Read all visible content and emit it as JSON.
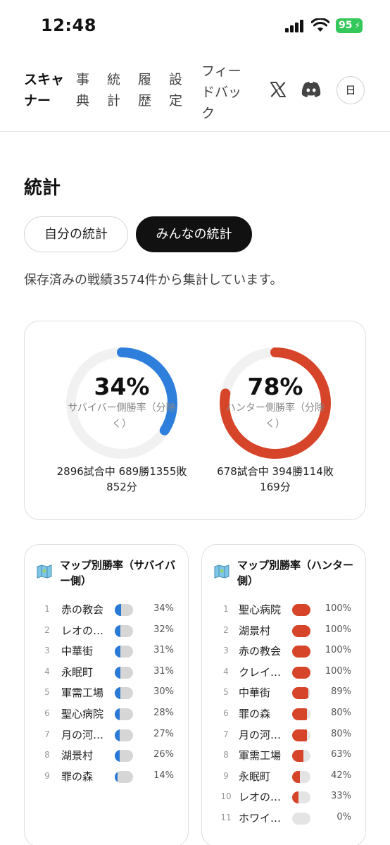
{
  "status_bar": {
    "time": "12:48",
    "battery": "95"
  },
  "nav": {
    "scanner": "スキャ\nナー",
    "dictionary": "事\n典",
    "stats": "統\n計",
    "history": "履\n歴",
    "settings": "設\n定",
    "feedback": "フィー\nドバッ\nク",
    "lang": "日"
  },
  "page": {
    "title": "統計",
    "tab_mine": "自分の統計",
    "tab_all": "みんなの統計",
    "summary": "保存済みの戦績3574件から集計しています。"
  },
  "overview": {
    "survivor": {
      "percent_text": "34%",
      "percent_value": 34,
      "label": "サバイバー側勝率（分除く）",
      "record_line1": "2896試合中 689勝1355敗",
      "record_line2": "852分",
      "color": "#2e7fdc"
    },
    "hunter": {
      "percent_text": "78%",
      "percent_value": 78,
      "label": "ハンター側勝率（分除く）",
      "record_line1": "678試合中 394勝114敗",
      "record_line2": "169分",
      "color": "#d6452a"
    }
  },
  "survivor_maps": {
    "title": "マップ別勝率（サバイバー側）",
    "rows": [
      {
        "rank": "1",
        "name": "赤の教会",
        "pct": "34%",
        "value": 34
      },
      {
        "rank": "2",
        "name": "レオの…",
        "pct": "32%",
        "value": 32
      },
      {
        "rank": "3",
        "name": "中華街",
        "pct": "31%",
        "value": 31
      },
      {
        "rank": "4",
        "name": "永眠町",
        "pct": "31%",
        "value": 31
      },
      {
        "rank": "5",
        "name": "軍需工場",
        "pct": "30%",
        "value": 30
      },
      {
        "rank": "6",
        "name": "聖心病院",
        "pct": "28%",
        "value": 28
      },
      {
        "rank": "7",
        "name": "月の河…",
        "pct": "27%",
        "value": 27
      },
      {
        "rank": "8",
        "name": "湖景村",
        "pct": "26%",
        "value": 26
      },
      {
        "rank": "9",
        "name": "罪の森",
        "pct": "14%",
        "value": 14
      }
    ]
  },
  "hunter_maps": {
    "title": "マップ別勝率（ハンター側）",
    "rows": [
      {
        "rank": "1",
        "name": "聖心病院",
        "pct": "100%",
        "value": 100
      },
      {
        "rank": "2",
        "name": "湖景村",
        "pct": "100%",
        "value": 100
      },
      {
        "rank": "3",
        "name": "赤の教会",
        "pct": "100%",
        "value": 100
      },
      {
        "rank": "4",
        "name": "クレイ…",
        "pct": "100%",
        "value": 100
      },
      {
        "rank": "5",
        "name": "中華街",
        "pct": "89%",
        "value": 89
      },
      {
        "rank": "6",
        "name": "罪の森",
        "pct": "80%",
        "value": 80
      },
      {
        "rank": "7",
        "name": "月の河…",
        "pct": "80%",
        "value": 80
      },
      {
        "rank": "8",
        "name": "軍需工場",
        "pct": "63%",
        "value": 63
      },
      {
        "rank": "9",
        "name": "永眠町",
        "pct": "42%",
        "value": 42
      },
      {
        "rank": "10",
        "name": "レオの…",
        "pct": "33%",
        "value": 33
      },
      {
        "rank": "11",
        "name": "ホワイ…",
        "pct": "0%",
        "value": 0
      }
    ]
  }
}
